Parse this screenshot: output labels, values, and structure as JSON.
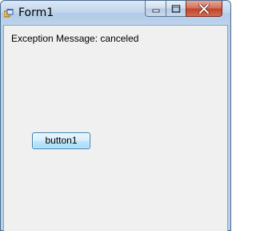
{
  "window": {
    "title": "Form1",
    "icon": "app-icon"
  },
  "caption": {
    "minimize_icon": "minimize-icon",
    "maximize_icon": "maximize-icon",
    "close_icon": "close-icon"
  },
  "form": {
    "message_label": "Exception Message: canceled",
    "button1_label": "button1"
  },
  "colors": {
    "client_background": "#f0f0f0",
    "close_button": "#c0442a",
    "button_border": "#3c7fb1"
  }
}
